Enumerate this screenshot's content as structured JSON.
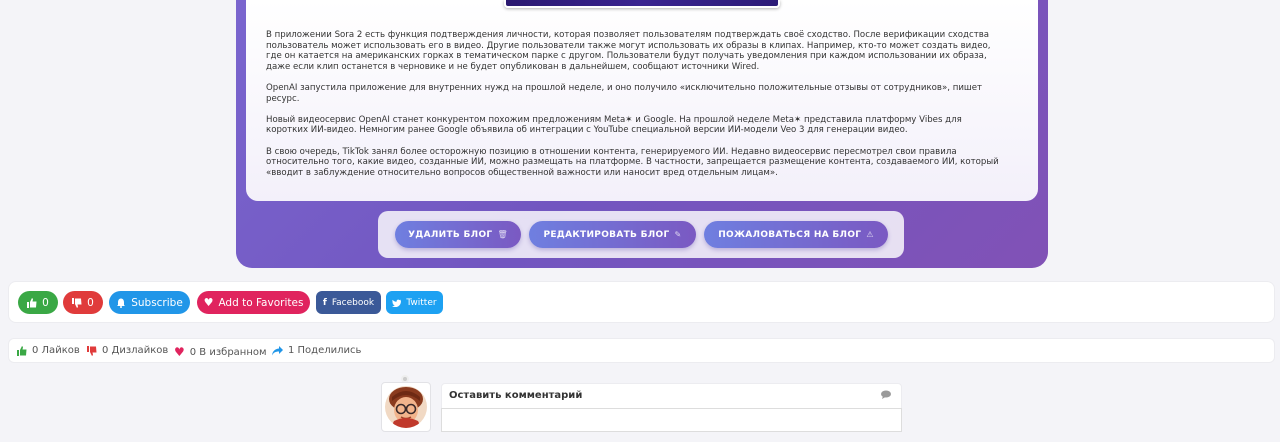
{
  "article": {
    "paragraphs": [
      "В приложении Sora 2 есть функция подтверждения личности, которая позволяет пользователям подтверждать своё сходство. После верификации сходства пользователь может использовать его в видео. Другие пользователи также могут использовать их образы в клипах. Например, кто-то может создать видео, где он катается на американских горках в тематическом парке с другом. Пользователи будут получать уведомления при каждом использовании их образа, даже если клип останется в черновике и не будет опубликован в дальнейшем, сообщают источники Wired.",
      "OpenAI запустила приложение для внутренних нужд на прошлой неделе, и оно получило «исключительно положительные отзывы от сотрудников», пишет ресурс.",
      "Новый видеосервис OpenAI станет конкурентом похожим предложениям Meta✶ и Google. На прошлой неделе Meta✶ представила платформу Vibes для коротких ИИ-видео. Немногим ранее Google объявила об интеграции с YouTube специальной версии ИИ-модели Veo 3 для генерации видео.",
      "В свою очередь, TikTok занял более осторожную позицию в отношении контента, генерируемого ИИ. Недавно видеосервис пересмотрел свои правила относительно того, какие видео, созданные ИИ, можно размещать на платформе. В частности, запрещается размещение контента, создаваемого ИИ, который «вводит в заблуждение относительно вопросов общественной важности или наносит вред отдельным лицам»."
    ]
  },
  "blog_actions": {
    "delete": {
      "label": "УДАЛИТЬ БЛОГ",
      "icon": "🗑"
    },
    "edit": {
      "label": "РЕДАКТИРОВАТЬ БЛОГ",
      "icon": "✎"
    },
    "report": {
      "label": "ПОЖАЛОВАТЬСЯ НА БЛОГ",
      "icon": "⚠"
    }
  },
  "social": {
    "like": {
      "count": "0",
      "color": "#3aa845"
    },
    "dislike": {
      "count": "0",
      "color": "#e03b3b"
    },
    "subscribe": {
      "label": "Subscribe",
      "color": "#2196e8"
    },
    "favorites": {
      "label": "Add to Favorites",
      "color": "#e0245e"
    },
    "facebook": {
      "label": "Facebook",
      "color": "#3b5998"
    },
    "twitter": {
      "label": "Twitter",
      "color": "#1da1f2"
    }
  },
  "stats": {
    "likes": "0 Лайков",
    "dislikes": "0 Дизлайков",
    "favorites": "0 В избранном",
    "shares": "1 Поделились"
  },
  "comments": {
    "title": "Оставить комментарий",
    "textarea_value": ""
  }
}
